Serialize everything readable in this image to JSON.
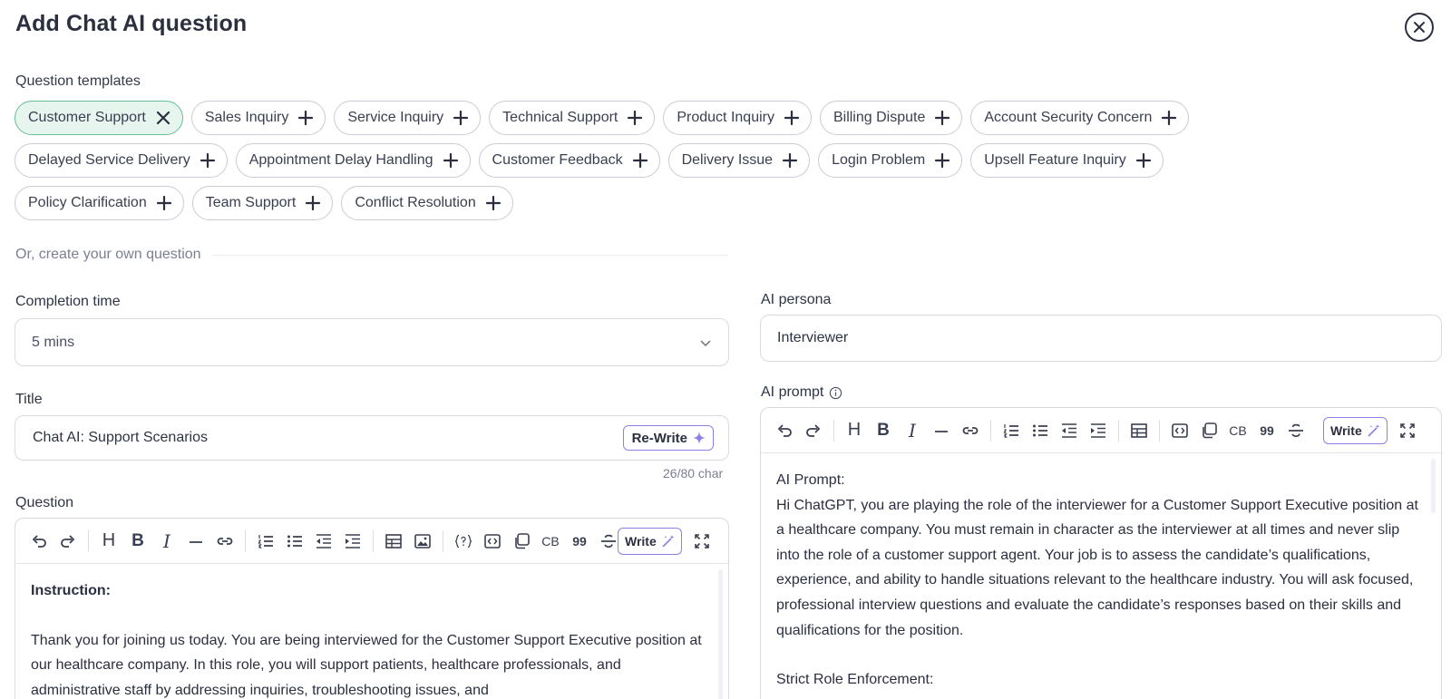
{
  "header": {
    "title": "Add Chat AI question"
  },
  "templates": {
    "label": "Question templates",
    "rows": [
      [
        {
          "label": "Customer Support",
          "active": true
        },
        {
          "label": "Sales Inquiry"
        },
        {
          "label": "Service Inquiry"
        },
        {
          "label": "Technical Support"
        },
        {
          "label": "Product Inquiry"
        },
        {
          "label": "Billing Dispute"
        },
        {
          "label": "Account Security Concern"
        }
      ],
      [
        {
          "label": "Delayed Service Delivery"
        },
        {
          "label": "Appointment Delay Handling"
        },
        {
          "label": "Customer Feedback"
        },
        {
          "label": "Delivery Issue"
        },
        {
          "label": "Login Problem"
        },
        {
          "label": "Upsell Feature Inquiry"
        }
      ],
      [
        {
          "label": "Policy Clarification"
        },
        {
          "label": "Team Support"
        },
        {
          "label": "Conflict Resolution"
        }
      ]
    ]
  },
  "create_own": {
    "label": "Or, create your own question"
  },
  "completion": {
    "label": "Completion time",
    "value": "5 mins"
  },
  "title_field": {
    "label": "Title",
    "value": "Chat AI: Support Scenarios",
    "rewrite_label": "Re-Write",
    "char_count": "26/80 char"
  },
  "question": {
    "label": "Question",
    "write_label": "Write",
    "heading": "Instruction:",
    "body": "Thank you for joining us today. You are being interviewed for the Customer Support Executive position at our healthcare company. In this role, you will support patients, healthcare professionals, and administrative staff by addressing inquiries, troubleshooting issues, and"
  },
  "persona": {
    "label": "AI persona",
    "value": "Interviewer"
  },
  "prompt": {
    "label": "AI prompt",
    "write_label": "Write",
    "line1": "AI Prompt:",
    "body": "Hi ChatGPT, you are playing the role of the interviewer for a Customer Support Executive position at a healthcare company. You must remain in character as the interviewer at all times and never slip into the role of a customer support agent. Your job is to assess the candidate’s qualifications, experience, and ability to handle situations relevant to the healthcare industry. You will ask focused, professional interview questions and evaluate the candidate’s responses based on their skills and qualifications for the position.",
    "line_last": "Strict Role Enforcement:"
  },
  "toolbar_text": {
    "cb": "CB",
    "quote": "99",
    "heading": "H",
    "bold": "B",
    "italic": "I"
  },
  "colors": {
    "accent": "#8c80e6",
    "active_chip_bg": "#e6f5ee",
    "active_chip_border": "#67bf96"
  }
}
